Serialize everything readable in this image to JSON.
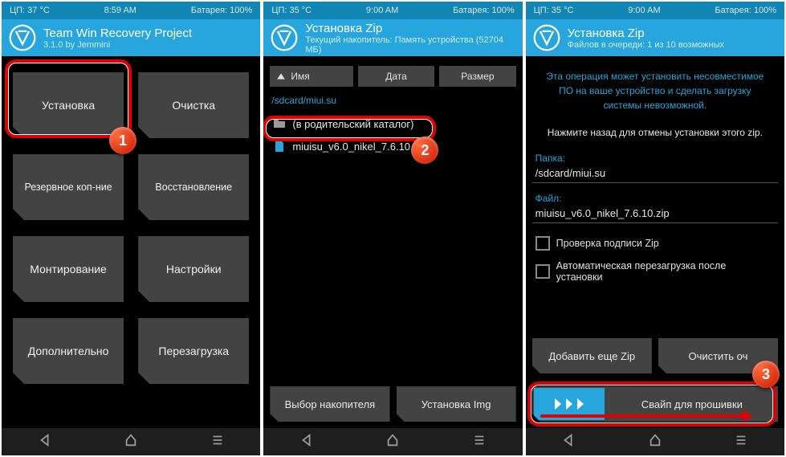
{
  "phones": {
    "p1": {
      "status": {
        "cpu": "ЦП: 37 °C",
        "time": "8:59 AM",
        "battery": "Батарея: 100%"
      },
      "header": {
        "title": "Team Win Recovery Project",
        "subtitle": "3.1.0 by Jemmini"
      },
      "tiles": {
        "install": "Установка",
        "wipe": "Очистка",
        "backup": "Резервное коп-ние",
        "restore": "Восстановление",
        "mount": "Монтирование",
        "settings": "Настройки",
        "advanced": "Дополнительно",
        "reboot": "Перезагрузка"
      },
      "badge": "1"
    },
    "p2": {
      "status": {
        "cpu": "ЦП: 35 °C",
        "time": "9:00 AM",
        "battery": "Батарея: 100%"
      },
      "header": {
        "title": "Установка Zip",
        "subtitle": "Текущий накопитель: Память устройства (52704 МБ)"
      },
      "sort": {
        "name": "Имя",
        "date": "Дата",
        "size": "Размер"
      },
      "path": "/sdcard/miui.su",
      "files": {
        "parent": "(в родительский каталог)",
        "zip": "miuisu_v6.0_nikel_7.6.10.zip"
      },
      "btns": {
        "storage": "Выбор накопителя",
        "img": "Установка Img"
      },
      "badge": "2"
    },
    "p3": {
      "status": {
        "cpu": "ЦП: 35 °C",
        "time": "9:00 AM",
        "battery": "Батарея: 100%"
      },
      "header": {
        "title": "Установка Zip",
        "subtitle": "Файлов в очереди: 1 из 10 возможных"
      },
      "warn": "Эта операция может установить несовместимое ПО на ваше устройство и сделать загрузку системы невозможной.",
      "info": "Нажмите назад для отмены установки этого zip.",
      "folder_label": "Папка:",
      "folder_value": "/sdcard/miui.su",
      "file_label": "Файл:",
      "file_value": "miuisu_v6.0_nikel_7.6.10.zip",
      "check1": "Проверка подписи Zip",
      "check2": "Автоматическая перезагрузка после установки",
      "btns": {
        "add": "Добавить еще Zip",
        "clear": "Очистить оч"
      },
      "swipe": "Свайп для прошивки",
      "badge": "3"
    }
  }
}
